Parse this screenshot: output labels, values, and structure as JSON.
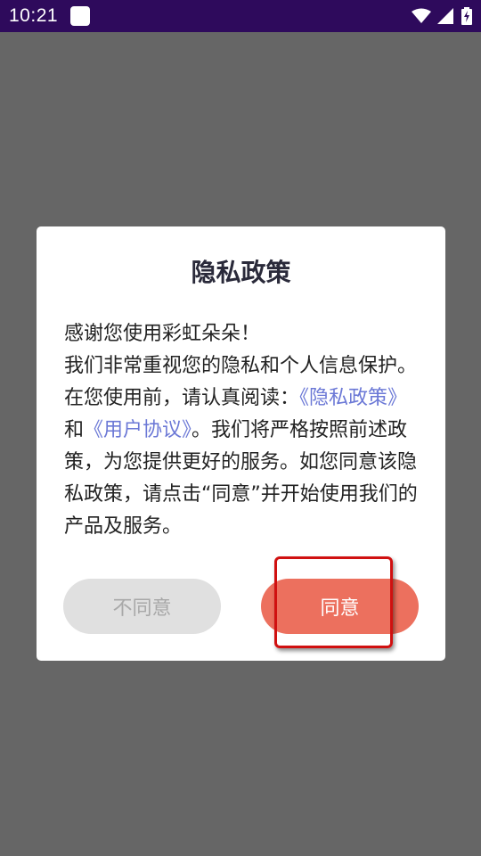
{
  "status_bar": {
    "time": "10:21",
    "icons": [
      "app-notification-icon",
      "wifi-icon",
      "signal-icon",
      "battery-charging-icon"
    ]
  },
  "dialog": {
    "title": "隐私政策",
    "body": {
      "greeting": "感谢您使用彩虹朵朵！",
      "text_before_links": "我们非常重视您的隐私和个人信息保护。在您使用前，请认真阅读：",
      "privacy_link": "《隐私政策》",
      "and_text": "和",
      "agreement_link": "《用户协议》",
      "text_after_links": "。我们将严格按照前述政策，为您提供更好的服务。如您同意该隐私政策，请点击“同意”并开始使用我们的产品及服务。"
    },
    "decline_label": "不同意",
    "agree_label": "同意"
  },
  "colors": {
    "status_bar": "#2e0a5c",
    "overlay": "#666666",
    "link": "#6b78d6",
    "agree_button": "#ec705e",
    "decline_button": "#e0e0e0",
    "highlight_box": "#d01010"
  }
}
